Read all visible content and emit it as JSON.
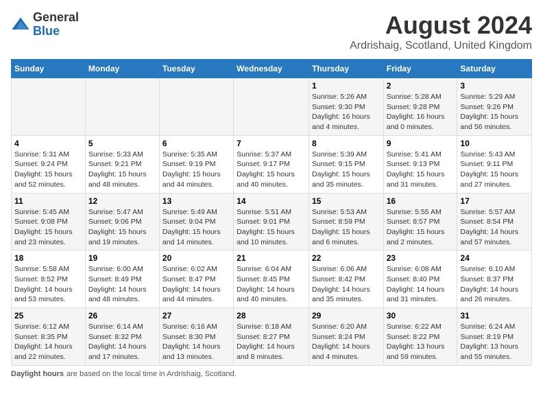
{
  "logo": {
    "general": "General",
    "blue": "Blue"
  },
  "title": "August 2024",
  "subtitle": "Ardrishaig, Scotland, United Kingdom",
  "weekdays": [
    "Sunday",
    "Monday",
    "Tuesday",
    "Wednesday",
    "Thursday",
    "Friday",
    "Saturday"
  ],
  "weeks": [
    [
      {
        "day": "",
        "sunrise": "",
        "sunset": "",
        "daylight": ""
      },
      {
        "day": "",
        "sunrise": "",
        "sunset": "",
        "daylight": ""
      },
      {
        "day": "",
        "sunrise": "",
        "sunset": "",
        "daylight": ""
      },
      {
        "day": "",
        "sunrise": "",
        "sunset": "",
        "daylight": ""
      },
      {
        "day": "1",
        "sunrise": "Sunrise: 5:26 AM",
        "sunset": "Sunset: 9:30 PM",
        "daylight": "Daylight: 16 hours and 4 minutes."
      },
      {
        "day": "2",
        "sunrise": "Sunrise: 5:28 AM",
        "sunset": "Sunset: 9:28 PM",
        "daylight": "Daylight: 16 hours and 0 minutes."
      },
      {
        "day": "3",
        "sunrise": "Sunrise: 5:29 AM",
        "sunset": "Sunset: 9:26 PM",
        "daylight": "Daylight: 15 hours and 56 minutes."
      }
    ],
    [
      {
        "day": "4",
        "sunrise": "Sunrise: 5:31 AM",
        "sunset": "Sunset: 9:24 PM",
        "daylight": "Daylight: 15 hours and 52 minutes."
      },
      {
        "day": "5",
        "sunrise": "Sunrise: 5:33 AM",
        "sunset": "Sunset: 9:21 PM",
        "daylight": "Daylight: 15 hours and 48 minutes."
      },
      {
        "day": "6",
        "sunrise": "Sunrise: 5:35 AM",
        "sunset": "Sunset: 9:19 PM",
        "daylight": "Daylight: 15 hours and 44 minutes."
      },
      {
        "day": "7",
        "sunrise": "Sunrise: 5:37 AM",
        "sunset": "Sunset: 9:17 PM",
        "daylight": "Daylight: 15 hours and 40 minutes."
      },
      {
        "day": "8",
        "sunrise": "Sunrise: 5:39 AM",
        "sunset": "Sunset: 9:15 PM",
        "daylight": "Daylight: 15 hours and 35 minutes."
      },
      {
        "day": "9",
        "sunrise": "Sunrise: 5:41 AM",
        "sunset": "Sunset: 9:13 PM",
        "daylight": "Daylight: 15 hours and 31 minutes."
      },
      {
        "day": "10",
        "sunrise": "Sunrise: 5:43 AM",
        "sunset": "Sunset: 9:11 PM",
        "daylight": "Daylight: 15 hours and 27 minutes."
      }
    ],
    [
      {
        "day": "11",
        "sunrise": "Sunrise: 5:45 AM",
        "sunset": "Sunset: 9:08 PM",
        "daylight": "Daylight: 15 hours and 23 minutes."
      },
      {
        "day": "12",
        "sunrise": "Sunrise: 5:47 AM",
        "sunset": "Sunset: 9:06 PM",
        "daylight": "Daylight: 15 hours and 19 minutes."
      },
      {
        "day": "13",
        "sunrise": "Sunrise: 5:49 AM",
        "sunset": "Sunset: 9:04 PM",
        "daylight": "Daylight: 15 hours and 14 minutes."
      },
      {
        "day": "14",
        "sunrise": "Sunrise: 5:51 AM",
        "sunset": "Sunset: 9:01 PM",
        "daylight": "Daylight: 15 hours and 10 minutes."
      },
      {
        "day": "15",
        "sunrise": "Sunrise: 5:53 AM",
        "sunset": "Sunset: 8:59 PM",
        "daylight": "Daylight: 15 hours and 6 minutes."
      },
      {
        "day": "16",
        "sunrise": "Sunrise: 5:55 AM",
        "sunset": "Sunset: 8:57 PM",
        "daylight": "Daylight: 15 hours and 2 minutes."
      },
      {
        "day": "17",
        "sunrise": "Sunrise: 5:57 AM",
        "sunset": "Sunset: 8:54 PM",
        "daylight": "Daylight: 14 hours and 57 minutes."
      }
    ],
    [
      {
        "day": "18",
        "sunrise": "Sunrise: 5:58 AM",
        "sunset": "Sunset: 8:52 PM",
        "daylight": "Daylight: 14 hours and 53 minutes."
      },
      {
        "day": "19",
        "sunrise": "Sunrise: 6:00 AM",
        "sunset": "Sunset: 8:49 PM",
        "daylight": "Daylight: 14 hours and 48 minutes."
      },
      {
        "day": "20",
        "sunrise": "Sunrise: 6:02 AM",
        "sunset": "Sunset: 8:47 PM",
        "daylight": "Daylight: 14 hours and 44 minutes."
      },
      {
        "day": "21",
        "sunrise": "Sunrise: 6:04 AM",
        "sunset": "Sunset: 8:45 PM",
        "daylight": "Daylight: 14 hours and 40 minutes."
      },
      {
        "day": "22",
        "sunrise": "Sunrise: 6:06 AM",
        "sunset": "Sunset: 8:42 PM",
        "daylight": "Daylight: 14 hours and 35 minutes."
      },
      {
        "day": "23",
        "sunrise": "Sunrise: 6:08 AM",
        "sunset": "Sunset: 8:40 PM",
        "daylight": "Daylight: 14 hours and 31 minutes."
      },
      {
        "day": "24",
        "sunrise": "Sunrise: 6:10 AM",
        "sunset": "Sunset: 8:37 PM",
        "daylight": "Daylight: 14 hours and 26 minutes."
      }
    ],
    [
      {
        "day": "25",
        "sunrise": "Sunrise: 6:12 AM",
        "sunset": "Sunset: 8:35 PM",
        "daylight": "Daylight: 14 hours and 22 minutes."
      },
      {
        "day": "26",
        "sunrise": "Sunrise: 6:14 AM",
        "sunset": "Sunset: 8:32 PM",
        "daylight": "Daylight: 14 hours and 17 minutes."
      },
      {
        "day": "27",
        "sunrise": "Sunrise: 6:16 AM",
        "sunset": "Sunset: 8:30 PM",
        "daylight": "Daylight: 14 hours and 13 minutes."
      },
      {
        "day": "28",
        "sunrise": "Sunrise: 6:18 AM",
        "sunset": "Sunset: 8:27 PM",
        "daylight": "Daylight: 14 hours and 8 minutes."
      },
      {
        "day": "29",
        "sunrise": "Sunrise: 6:20 AM",
        "sunset": "Sunset: 8:24 PM",
        "daylight": "Daylight: 14 hours and 4 minutes."
      },
      {
        "day": "30",
        "sunrise": "Sunrise: 6:22 AM",
        "sunset": "Sunset: 8:22 PM",
        "daylight": "Daylight: 13 hours and 59 minutes."
      },
      {
        "day": "31",
        "sunrise": "Sunrise: 6:24 AM",
        "sunset": "Sunset: 8:19 PM",
        "daylight": "Daylight: 13 hours and 55 minutes."
      }
    ]
  ],
  "footer": {
    "label": "Daylight hours",
    "text": "are based on the local time in Ardrishaig, Scotland."
  }
}
